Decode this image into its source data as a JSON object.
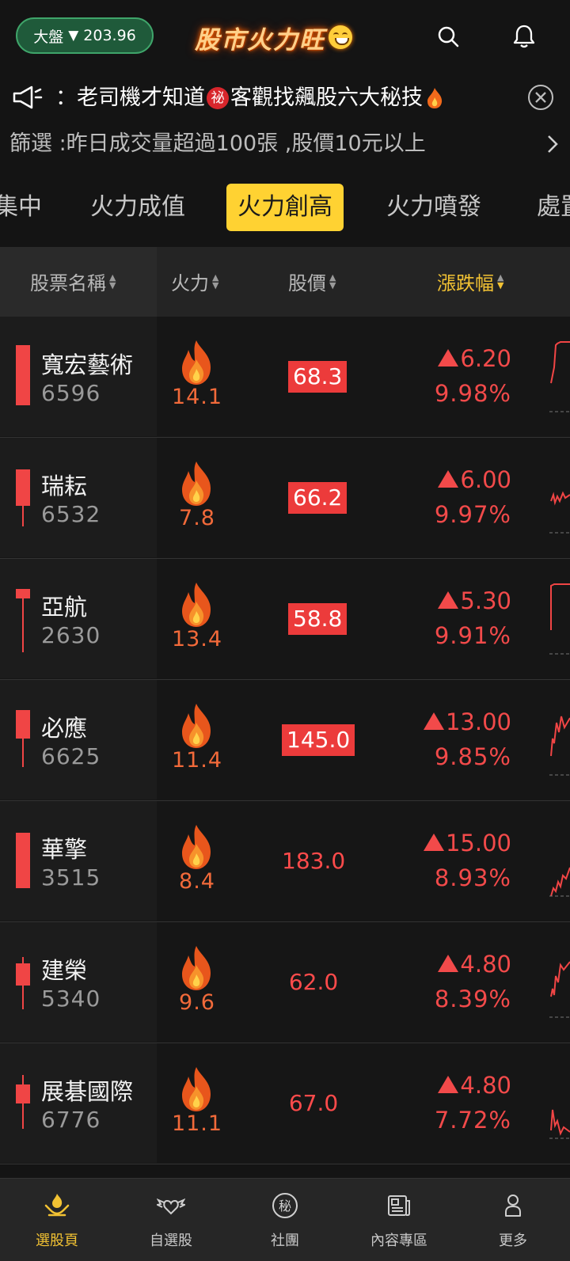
{
  "header": {
    "market_label": "大盤",
    "market_arrow": "▼",
    "market_value": "203.96",
    "app_title": "股市火力旺",
    "icons": [
      "search-icon",
      "bell-icon"
    ]
  },
  "announcement": {
    "text_prefix": "：老司機才知道",
    "badge": "祕",
    "text_suffix": "客觀找飆股六大秘技",
    "icons": [
      "speaker-icon",
      "fire-emoji-icon",
      "close-icon"
    ]
  },
  "filter": {
    "text": "篩選 :昨日成交量超過100張 ,股價10元以上"
  },
  "tabs": [
    {
      "label": "集中"
    },
    {
      "label": "火力成值"
    },
    {
      "label": "火力創高",
      "active": true
    },
    {
      "label": "火力噴發"
    },
    {
      "label": "處置"
    }
  ],
  "columns": {
    "name": "股票名稱",
    "fire": "火力",
    "price": "股價",
    "change": "漲跌幅"
  },
  "rows": [
    {
      "name": "寬宏藝術",
      "code": "6596",
      "fire": "14.1",
      "price": "68.3",
      "change": "6.20",
      "pct": "9.98%",
      "highlight": true
    },
    {
      "name": "瑞耘",
      "code": "6532",
      "fire": "7.8",
      "price": "66.2",
      "change": "6.00",
      "pct": "9.97%",
      "highlight": true
    },
    {
      "name": "亞航",
      "code": "2630",
      "fire": "13.4",
      "price": "58.8",
      "change": "5.30",
      "pct": "9.91%",
      "highlight": true
    },
    {
      "name": "必應",
      "code": "6625",
      "fire": "11.4",
      "price": "145.0",
      "change": "13.00",
      "pct": "9.85%",
      "highlight": true
    },
    {
      "name": "華擎",
      "code": "3515",
      "fire": "8.4",
      "price": "183.0",
      "change": "15.00",
      "pct": "8.93%",
      "highlight": false
    },
    {
      "name": "建榮",
      "code": "5340",
      "fire": "9.6",
      "price": "62.0",
      "change": "4.80",
      "pct": "8.39%",
      "highlight": false
    },
    {
      "name": "展碁國際",
      "code": "6776",
      "fire": "11.1",
      "price": "67.0",
      "change": "4.80",
      "pct": "7.72%",
      "highlight": false
    }
  ],
  "nav": [
    {
      "label": "選股頁",
      "icon": "fire-hands-icon",
      "active": true
    },
    {
      "label": "自選股",
      "icon": "winged-heart-icon"
    },
    {
      "label": "社團",
      "icon": "secret-circle-icon"
    },
    {
      "label": "內容專區",
      "icon": "newspaper-icon"
    },
    {
      "label": "更多",
      "icon": "person-icon"
    }
  ],
  "colors": {
    "up_red": "#f24a4a",
    "accent_yellow": "#ffd232",
    "market_green": "#1f5a3a",
    "background": "#141414"
  }
}
